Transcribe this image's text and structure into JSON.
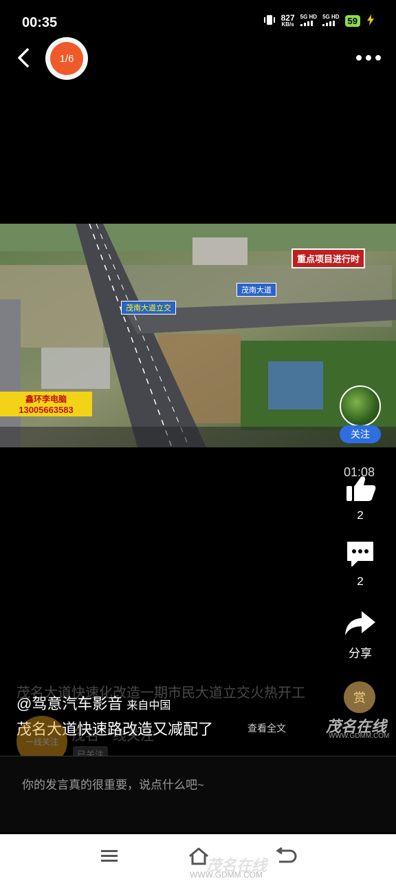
{
  "status_bar": {
    "time": "00:35",
    "net_speed": "827",
    "net_unit": "KB/s",
    "sim1": "5G HD",
    "sim2": "5G HD",
    "battery": "59"
  },
  "top_bar": {
    "pager": "1/6"
  },
  "video": {
    "overlay_label_red": "重点项目进行时",
    "road_sign_1": "茂南大道",
    "road_sign_2": "茂南大道立交",
    "ad_title": "鑫环李电脑",
    "ad_phone": "13005663583",
    "time_display": "01:08"
  },
  "rail": {
    "follow_label": "关注",
    "like_count": "2",
    "comment_count": "2",
    "share_label": "分享",
    "reward_label": "赏"
  },
  "caption": {
    "ghost_line": "茂名大道快速化改造一期市民大道立交火热开工",
    "author": "@驾意汽车影音",
    "source": "来自中国",
    "description": "茂名大道快速路改造又减配了",
    "more": "查看全文",
    "ghost_account": "茂名一线关注",
    "ghost_followed": "已关注",
    "ghost_badge": "一线关注",
    "watermark": "茂名在线",
    "watermark_url": "WWW.GDMM.COM"
  },
  "comment": {
    "placeholder": "你的发言真的很重要，说点什么吧~"
  },
  "nav": {
    "watermark": "茂名在线",
    "watermark_url": "WWW.GDMM.COM"
  },
  "colors": {
    "pager_orange": "#f05a2a",
    "follow_blue": "#2f6ee0",
    "battery_green": "#8bdc4a"
  }
}
